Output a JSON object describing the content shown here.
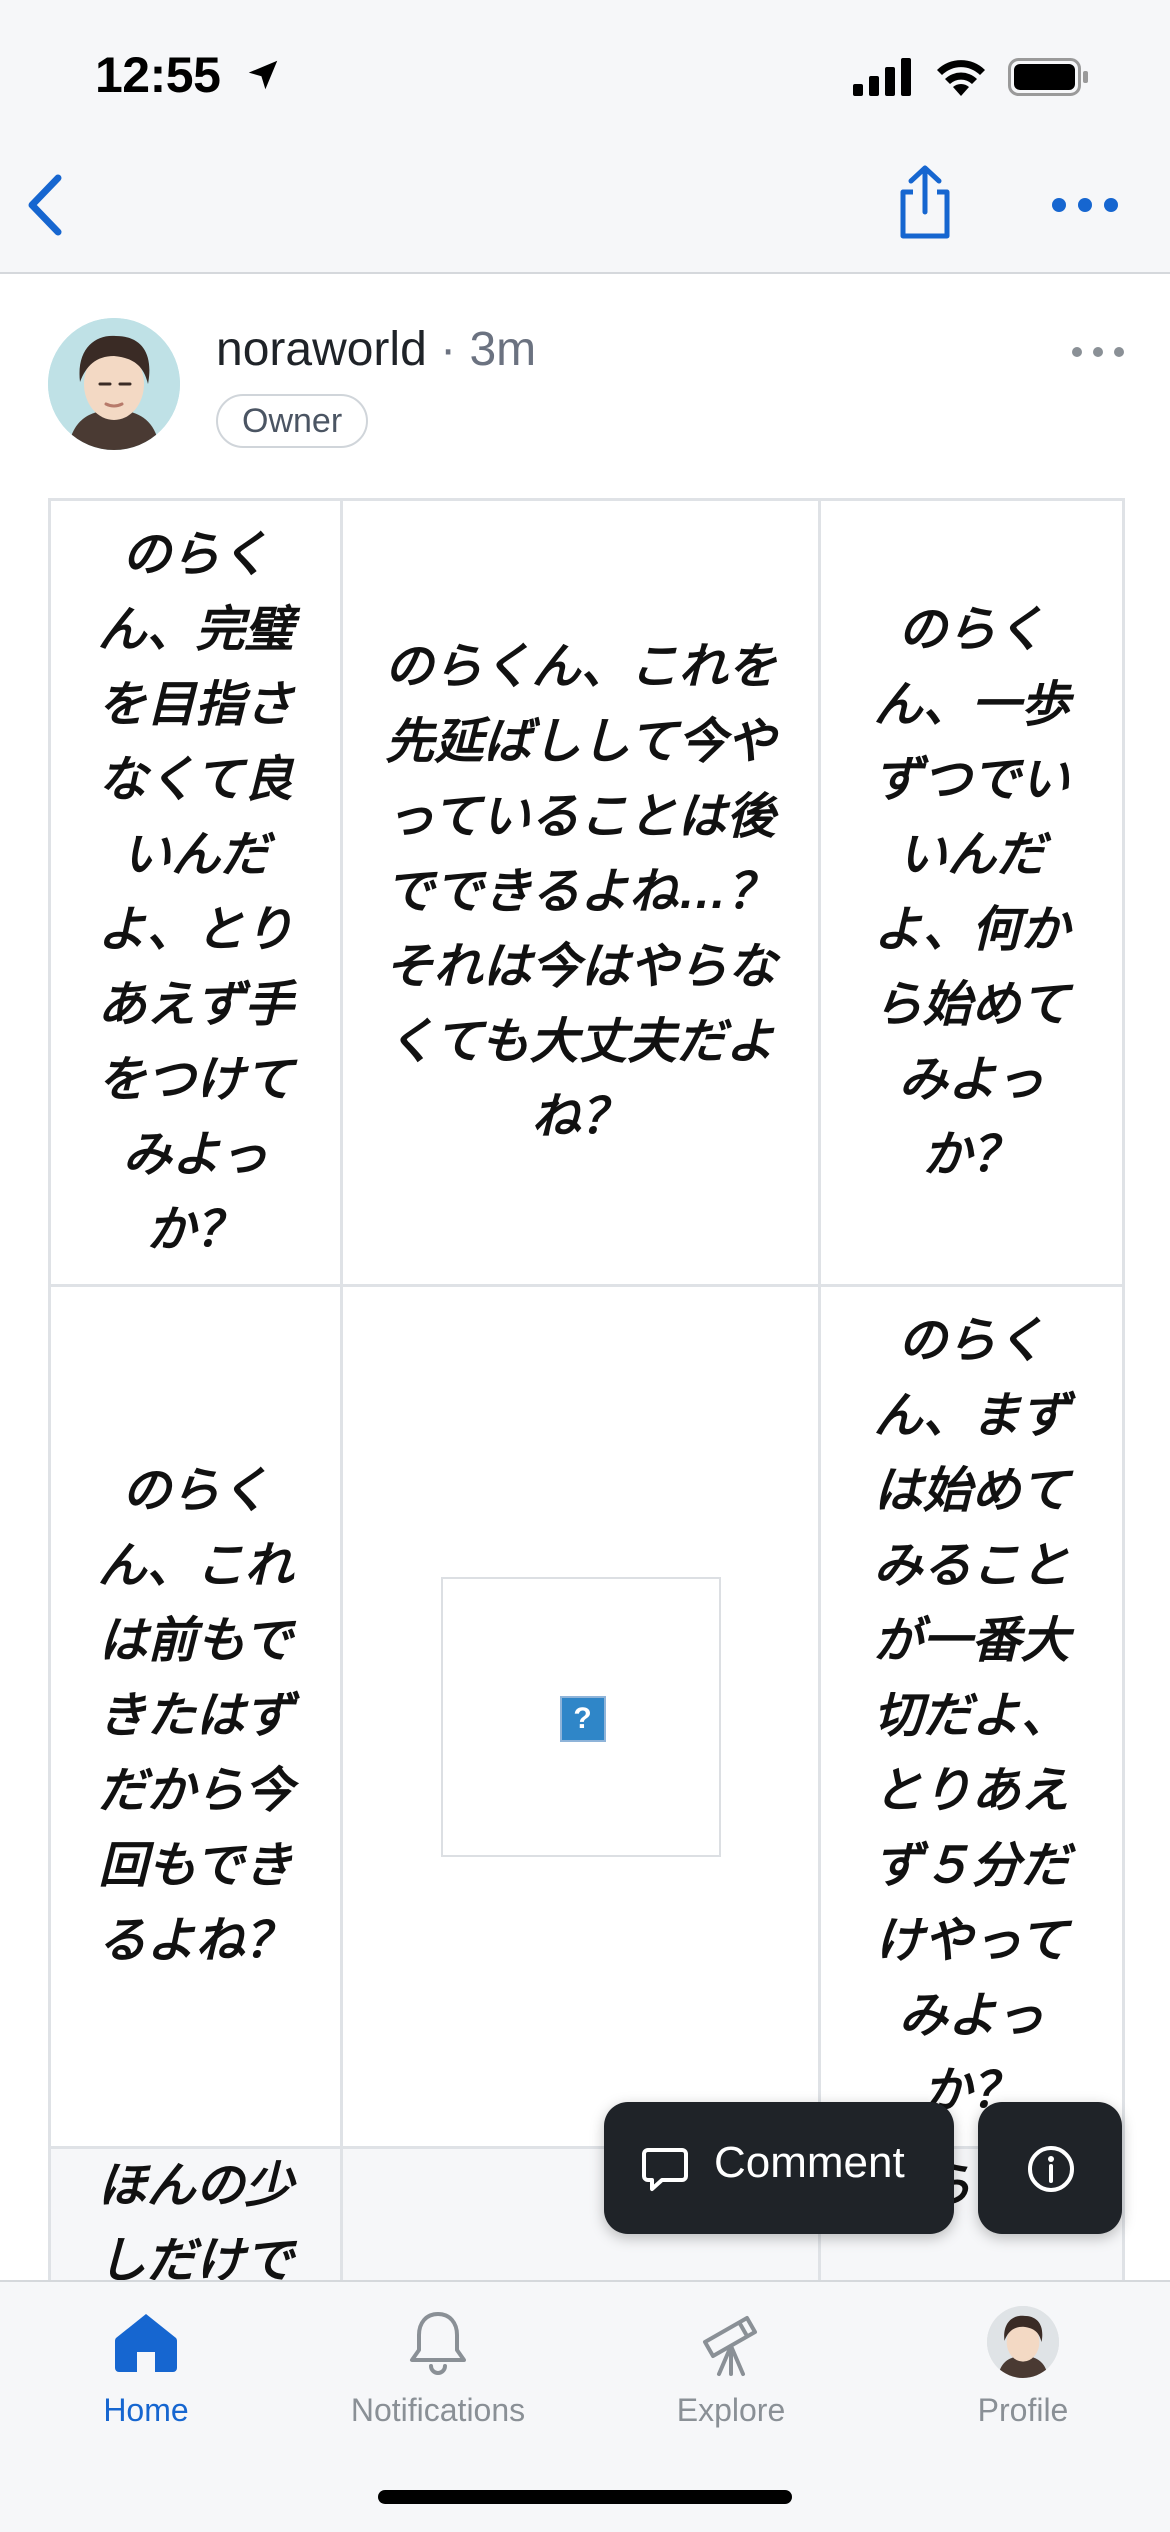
{
  "status_bar": {
    "time": "12:55"
  },
  "post": {
    "author": "noraworld",
    "separator": "·",
    "time_ago": "3m",
    "badge": "Owner"
  },
  "table": {
    "rows": [
      [
        "のらくん、完璧を目指さなくて良いんだよ、とりあえず手をつけてみよっか？",
        "のらくん、これを先延ばしして今やっていることは後でできるよね…？ それは今はやらなくても大丈夫だよね？",
        "のらくん、一歩ずつでいいんだよ、何から始めてみよっか？"
      ],
      [
        "のらくん、これは前もできたはずだから今回もできるよね？",
        "?",
        "のらくん、まずは始めてみることが一番大切だよ、とりあえず５分だけやってみよっか？"
      ],
      [
        "ほんの少しだけで",
        "",
        "のらくん"
      ]
    ]
  },
  "actions": {
    "comment_label": "Comment"
  },
  "tabs": [
    {
      "label": "Home",
      "icon": "home-icon",
      "active": true
    },
    {
      "label": "Notifications",
      "icon": "bell-icon",
      "active": false
    },
    {
      "label": "Explore",
      "icon": "telescope-icon",
      "active": false
    },
    {
      "label": "Profile",
      "icon": "avatar",
      "active": false
    }
  ],
  "colors": {
    "accent": "#1666d0",
    "bar_background": "#f6f7f9",
    "dark_button": "#1f2328",
    "muted_text": "#8a9096"
  }
}
